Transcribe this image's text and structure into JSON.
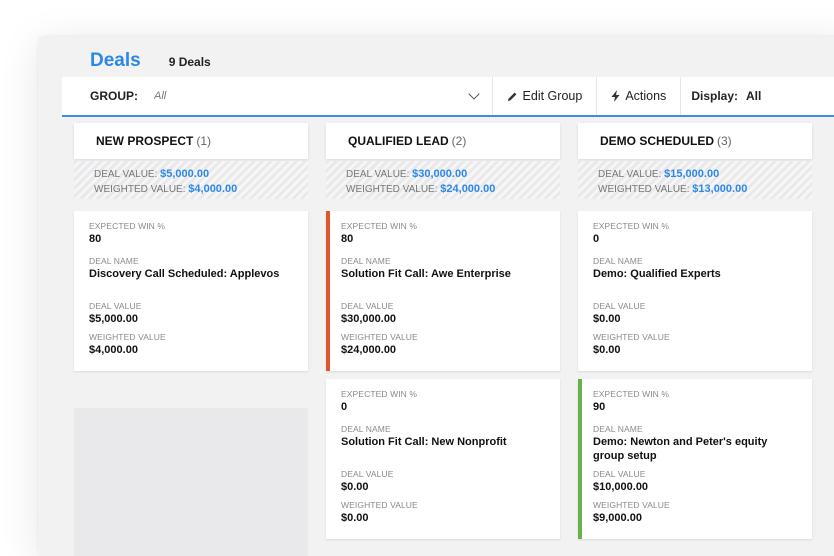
{
  "header": {
    "title": "Deals",
    "count": "9 Deals"
  },
  "toolbar": {
    "group_label": "GROUP:",
    "group_placeholder": "All",
    "edit_group_label": "Edit Group",
    "actions_label": "Actions",
    "display_label": "Display:",
    "display_value": "All"
  },
  "labels": {
    "deal_value": "DEAL VALUE:",
    "weighted_value": "WEIGHTED VALUE:",
    "expected_win": "EXPECTED WIN %",
    "deal_name": "DEAL NAME",
    "card_deal_value": "DEAL VALUE",
    "card_weighted_value": "WEIGHTED VALUE"
  },
  "columns": [
    {
      "name": "NEW PROSPECT",
      "count": "(1)",
      "deal_value": "$5,000.00",
      "weighted_value": "$4,000.00",
      "cards": [
        {
          "win": "80",
          "name": "Discovery Call Scheduled: Applevos",
          "deal_value": "$5,000.00",
          "weighted_value": "$4,000.00"
        }
      ]
    },
    {
      "name": "QUALIFIED LEAD",
      "count": "(2)",
      "deal_value": "$30,000.00",
      "weighted_value": "$24,000.00",
      "cards": [
        {
          "win": "80",
          "name": "Solution Fit Call: Awe Enterprise",
          "deal_value": "$30,000.00",
          "weighted_value": "$24,000.00"
        },
        {
          "win": "0",
          "name": "Solution Fit Call: New Nonprofit",
          "deal_value": "$0.00",
          "weighted_value": "$0.00"
        }
      ]
    },
    {
      "name": "DEMO SCHEDULED",
      "count": "(3)",
      "deal_value": "$15,000.00",
      "weighted_value": "$13,000.00",
      "cards": [
        {
          "win": "0",
          "name": "Demo: Qualified Experts",
          "deal_value": "$0.00",
          "weighted_value": "$0.00"
        },
        {
          "win": "90",
          "name": "Demo: Newton and Peter's equity group setup",
          "deal_value": "$10,000.00",
          "weighted_value": "$9,000.00"
        }
      ]
    }
  ],
  "colors": {
    "accent_blue": "#2c88e8",
    "accent_red": "#e0562e",
    "accent_green": "#6ab04c"
  }
}
